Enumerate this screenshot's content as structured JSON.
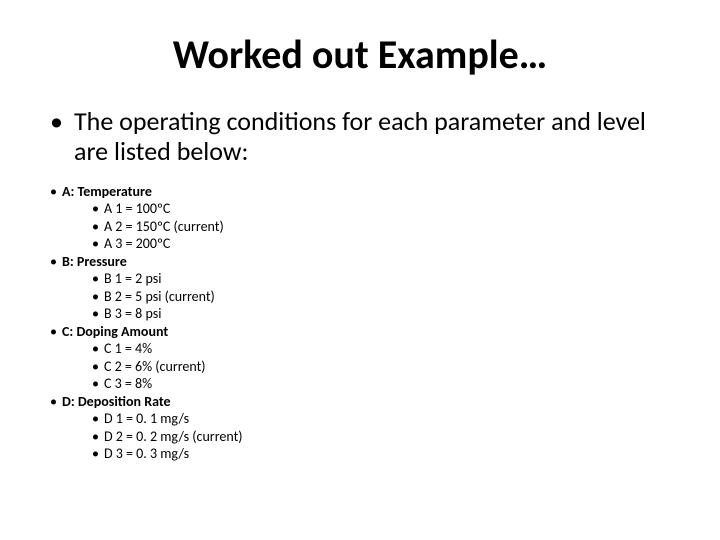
{
  "title": "Worked out Example…",
  "intro": "The operating conditions for each parameter and level are listed below:",
  "params": [
    {
      "head": "A: Temperature",
      "levels": [
        "A 1 = 100ºC",
        "A 2 = 150ºC (current)",
        "A 3 = 200ºC"
      ]
    },
    {
      "head": "B: Pressure",
      "levels": [
        "B 1 = 2 psi",
        "B 2 = 5 psi (current)",
        "B 3 = 8 psi"
      ]
    },
    {
      "head": "C: Doping Amount",
      "levels": [
        "C 1 = 4%",
        "C 2 = 6% (current)",
        "C 3 = 8%"
      ]
    },
    {
      "head": "D: Deposition Rate",
      "levels": [
        "D 1 = 0. 1 mg/s",
        "D 2 = 0. 2 mg/s (current)",
        "D 3 = 0. 3 mg/s"
      ]
    }
  ]
}
